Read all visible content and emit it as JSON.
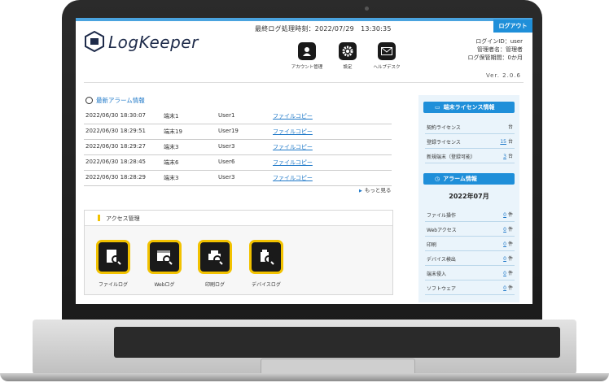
{
  "header": {
    "logout_label": "ログアウト",
    "last_log_label": "最終ログ処理時刻：2022/07/29　13:30:35",
    "logo_text": "LogKeeper",
    "nav": [
      {
        "label": "アカウント管理",
        "icon": "person-icon"
      },
      {
        "label": "設定",
        "icon": "gear-icon"
      },
      {
        "label": "ヘルプデスク",
        "icon": "mail-icon"
      }
    ],
    "login_id": "ログインID：user",
    "admin_name": "管理者名：管理者",
    "retention": "ログ保管期間：0か月",
    "version": "Ver. 2.0.6"
  },
  "alarms": {
    "title": "最新アラーム情報",
    "rows": [
      {
        "datetime": "2022/06/30 18:30:07",
        "terminal": "端末1",
        "user": "User1",
        "action": "ファイルコピー"
      },
      {
        "datetime": "2022/06/30 18:29:51",
        "terminal": "端末19",
        "user": "User19",
        "action": "ファイルコピー"
      },
      {
        "datetime": "2022/06/30 18:29:27",
        "terminal": "端末3",
        "user": "User3",
        "action": "ファイルコピー"
      },
      {
        "datetime": "2022/06/30 18:28:45",
        "terminal": "端末6",
        "user": "User6",
        "action": "ファイルコピー"
      },
      {
        "datetime": "2022/06/30 18:28:29",
        "terminal": "端末3",
        "user": "User3",
        "action": "ファイルコピー"
      }
    ],
    "more_label": "もっと見る"
  },
  "access": {
    "title": "アクセス管理",
    "buttons": [
      {
        "label": "ファイルログ"
      },
      {
        "label": "Webログ"
      },
      {
        "label": "印刷ログ"
      },
      {
        "label": "デバイスログ"
      }
    ]
  },
  "license": {
    "title": "端末ライセンス情報",
    "rows": [
      {
        "label": "契約ライセンス",
        "value": "",
        "unit": "台"
      },
      {
        "label": "登録ライセンス",
        "value": "15",
        "unit": "台"
      },
      {
        "label": "新規端末（登録可能）",
        "value": "3",
        "unit": "台"
      }
    ]
  },
  "alarm_info": {
    "title": "アラーム情報",
    "month": "2022年07月",
    "rows": [
      {
        "label": "ファイル操作",
        "value": "0",
        "unit": "件"
      },
      {
        "label": "Webアクセス",
        "value": "0",
        "unit": "件"
      },
      {
        "label": "印刷",
        "value": "0",
        "unit": "件"
      },
      {
        "label": "デバイス検出",
        "value": "0",
        "unit": "件"
      },
      {
        "label": "端末侵入",
        "value": "0",
        "unit": "件"
      },
      {
        "label": "ソフトウェア",
        "value": "0",
        "unit": "件"
      }
    ]
  }
}
